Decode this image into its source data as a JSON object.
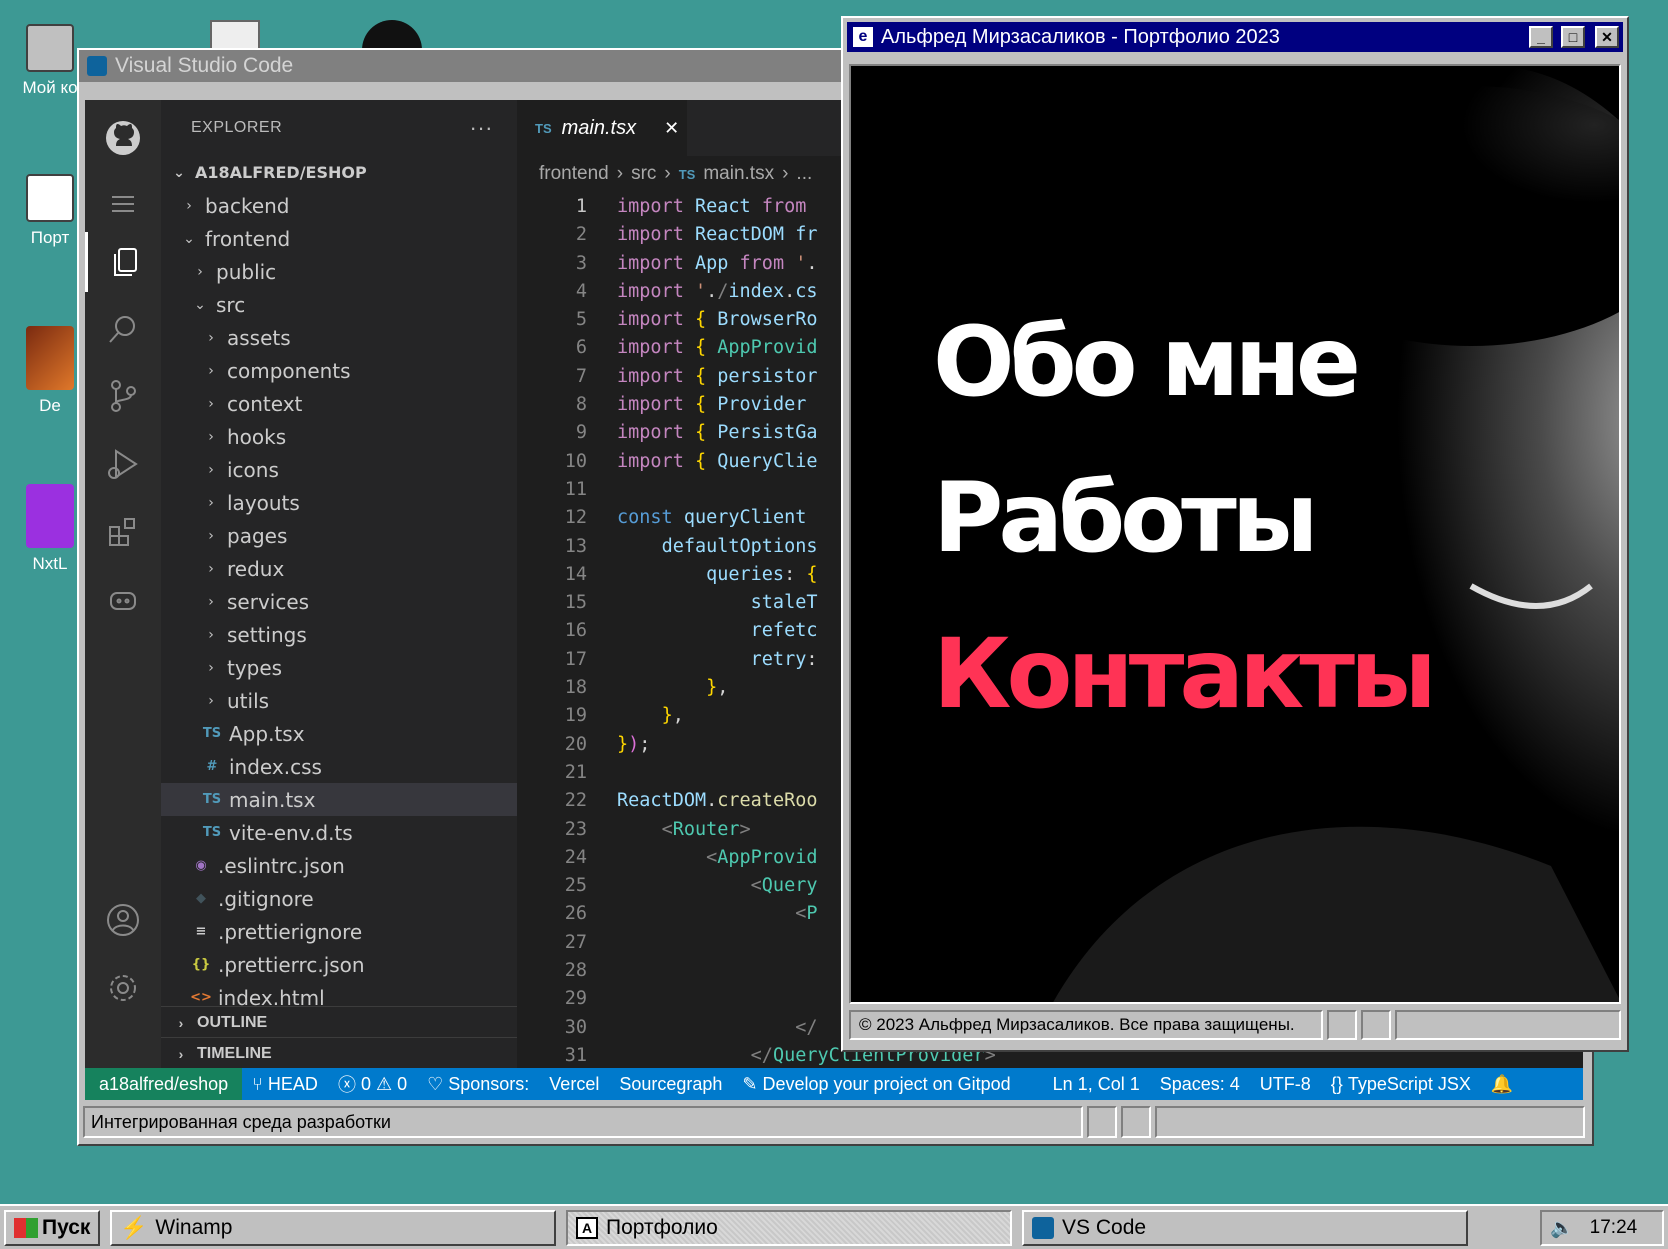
{
  "desktop": {
    "icons": [
      {
        "label": "Мой ко"
      },
      {
        "label": "Порт"
      },
      {
        "label": "De"
      },
      {
        "label": "NxtL"
      }
    ]
  },
  "vscode_window": {
    "title": "Visual Studio Code",
    "explorer": {
      "header": "EXPLORER",
      "more": "···",
      "root": "A18ALFRED/ESHOP",
      "tree": [
        {
          "label": "backend",
          "chev": "›",
          "depth": 1
        },
        {
          "label": "frontend",
          "chev": "⌄",
          "depth": 1
        },
        {
          "label": "public",
          "chev": "›",
          "depth": 2
        },
        {
          "label": "src",
          "chev": "⌄",
          "depth": 2
        },
        {
          "label": "assets",
          "chev": "›",
          "depth": 3
        },
        {
          "label": "components",
          "chev": "›",
          "depth": 3
        },
        {
          "label": "context",
          "chev": "›",
          "depth": 3
        },
        {
          "label": "hooks",
          "chev": "›",
          "depth": 3
        },
        {
          "label": "icons",
          "chev": "›",
          "depth": 3
        },
        {
          "label": "layouts",
          "chev": "›",
          "depth": 3
        },
        {
          "label": "pages",
          "chev": "›",
          "depth": 3
        },
        {
          "label": "redux",
          "chev": "›",
          "depth": 3
        },
        {
          "label": "services",
          "chev": "›",
          "depth": 3
        },
        {
          "label": "settings",
          "chev": "›",
          "depth": 3
        },
        {
          "label": "types",
          "chev": "›",
          "depth": 3
        },
        {
          "label": "utils",
          "chev": "›",
          "depth": 3
        },
        {
          "label": "App.tsx",
          "icon": "TS",
          "depth": 3
        },
        {
          "label": "index.css",
          "icon": "#",
          "depth": 3
        },
        {
          "label": "main.tsx",
          "icon": "TS",
          "depth": 3,
          "selected": true
        },
        {
          "label": "vite-env.d.ts",
          "icon": "TS",
          "depth": 3
        },
        {
          "label": ".eslintrc.json",
          "icon": "◉",
          "depth": 2
        },
        {
          "label": ".gitignore",
          "icon": "◆",
          "depth": 2
        },
        {
          "label": ".prettierignore",
          "icon": "≡",
          "depth": 2
        },
        {
          "label": ".prettierrc.json",
          "icon": "{}",
          "depth": 2
        },
        {
          "label": "index.html",
          "icon": "<>",
          "depth": 2
        }
      ],
      "outline": "OUTLINE",
      "timeline": "TIMELINE"
    },
    "tab": {
      "badge": "TS",
      "label": "main.tsx",
      "close": "✕"
    },
    "breadcrumb": [
      "frontend",
      "src",
      "main.tsx",
      "..."
    ],
    "breadcrumb_badge": "TS",
    "code_lines": [
      "import React from",
      "import ReactDOM fr",
      "import App from '.",
      "import './index.cs",
      "import { BrowserRo",
      "import { AppProvid",
      "import { persistor",
      "import { Provider",
      "import { PersistGa",
      "import { QueryClie",
      "",
      "const queryClient",
      "    defaultOptions",
      "        queries: {",
      "            staleT",
      "            refetc",
      "            retry:",
      "        },",
      "    },",
      "});",
      "",
      "ReactDOM.createRoo",
      "    <Router>",
      "        <AppProvid",
      "            <Query",
      "                <P",
      "",
      "",
      "",
      "                </",
      "            </QueryClientProvider>"
    ],
    "status": {
      "remote": "a18alfred/eshop",
      "branch": "HEAD",
      "errors": "0",
      "warnings": "0",
      "sponsors": "Sponsors:",
      "vercel": "Vercel",
      "sourcegraph": "Sourcegraph",
      "gitpod": "Develop your project on Gitpod",
      "position": "Ln 1, Col 1",
      "spaces": "Spaces: 4",
      "encoding": "UTF-8",
      "language": "TypeScript JSX"
    },
    "footer_text": "Интегрированная среда разработки"
  },
  "portfolio_window": {
    "title": "Альфред Мирзасаликов - Портфолио 2023",
    "menu": [
      {
        "label": "Обо мне",
        "color": "#ffffff"
      },
      {
        "label": "Работы",
        "color": "#ffffff"
      },
      {
        "label": "Контакты",
        "color": "#ff3355"
      }
    ],
    "footer_text": "© 2023 Альфред Мирзасаликов. Все права защищены."
  },
  "taskbar": {
    "start": "Пуск",
    "tasks": [
      {
        "label": "Winamp"
      },
      {
        "label": "Портфолио"
      },
      {
        "label": "VS Code"
      }
    ],
    "clock": "17:24"
  },
  "colors": {
    "desktop": "#3d9994",
    "title_active": "#000080",
    "vscode_status": "#007acc",
    "accent_contacts": "#ff3355"
  }
}
